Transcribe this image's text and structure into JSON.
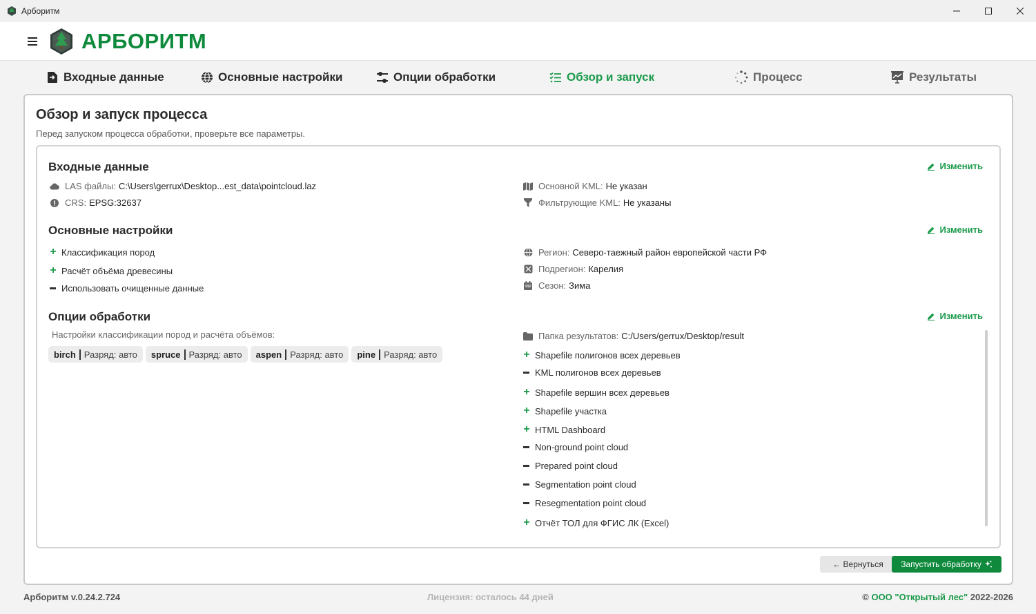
{
  "window": {
    "title": "Арборитм"
  },
  "header": {
    "brand": "АРБОРИТМ"
  },
  "tabs": [
    {
      "label": "Входные данные",
      "icon": "file-import-icon"
    },
    {
      "label": "Основные настройки",
      "icon": "globe-icon"
    },
    {
      "label": "Опции обработки",
      "icon": "sliders-icon"
    },
    {
      "label": "Обзор и запуск",
      "icon": "checklist-icon"
    },
    {
      "label": "Процесс",
      "icon": "spinner-icon"
    },
    {
      "label": "Результаты",
      "icon": "chart-presentation-icon"
    }
  ],
  "page": {
    "title": "Обзор и запуск процесса",
    "subtitle": "Перед запуском процесса обработки, проверьте все параметры."
  },
  "edit_label": "Изменить",
  "input_section": {
    "title": "Входные данные",
    "las_label": "LAS файлы:",
    "las_value": "C:\\Users\\gerrux\\Desktop...est_data\\pointcloud.laz",
    "crs_label": "CRS:",
    "crs_value": "EPSG:32637",
    "kml_label": "Основной KML:",
    "kml_value": "Не указан",
    "filter_kml_label": "Фильтрующие KML:",
    "filter_kml_value": "Не указаны"
  },
  "settings_section": {
    "title": "Основные настройки",
    "options": [
      {
        "label": "Классификация пород",
        "enabled": true
      },
      {
        "label": "Расчёт объёма древесины",
        "enabled": true
      },
      {
        "label": "Использовать очищенные данные",
        "enabled": false
      }
    ],
    "region_label": "Регион:",
    "region_value": "Северо-таежный район европейской части РФ",
    "subregion_label": "Подрегион:",
    "subregion_value": "Карелия",
    "season_label": "Сезон:",
    "season_value": "Зима"
  },
  "processing_section": {
    "title": "Опции обработки",
    "classification_caption": "Настройки классификации пород и расчёта объёмов:",
    "species": [
      {
        "name": "birch",
        "rank": "Разряд: авто"
      },
      {
        "name": "spruce",
        "rank": "Разряд: авто"
      },
      {
        "name": "aspen",
        "rank": "Разряд: авто"
      },
      {
        "name": "pine",
        "rank": "Разряд: авто"
      }
    ],
    "result_folder_label": "Папка результатов:",
    "result_folder_value": "C:/Users/gerrux/Desktop/result",
    "outputs": [
      {
        "label": "Shapefile полигонов всех деревьев",
        "enabled": true
      },
      {
        "label": "KML полигонов всех деревьев",
        "enabled": false
      },
      {
        "label": "Shapefile вершин всех деревьев",
        "enabled": true
      },
      {
        "label": "Shapefile участка",
        "enabled": true
      },
      {
        "label": "HTML Dashboard",
        "enabled": true
      },
      {
        "label": "Non-ground point cloud",
        "enabled": false
      },
      {
        "label": "Prepared point cloud",
        "enabled": false
      },
      {
        "label": "Segmentation point cloud",
        "enabled": false
      },
      {
        "label": "Resegmentation point cloud",
        "enabled": false
      },
      {
        "label": "Отчёт ТОЛ для ФГИС ЛК (Excel)",
        "enabled": true
      }
    ]
  },
  "actions": {
    "back_label": "← Вернуться",
    "run_label": "Запустить обработку"
  },
  "footer": {
    "version": "Арборитм v.0.24.2.724",
    "license": "Лицензия: осталось 44 дней",
    "copyright_symbol": "©",
    "company": "ООО \"Открытый лес\"",
    "years": "2022-2026"
  },
  "colors": {
    "accent": "#1a9a4a",
    "brand": "#0d8a3c"
  }
}
